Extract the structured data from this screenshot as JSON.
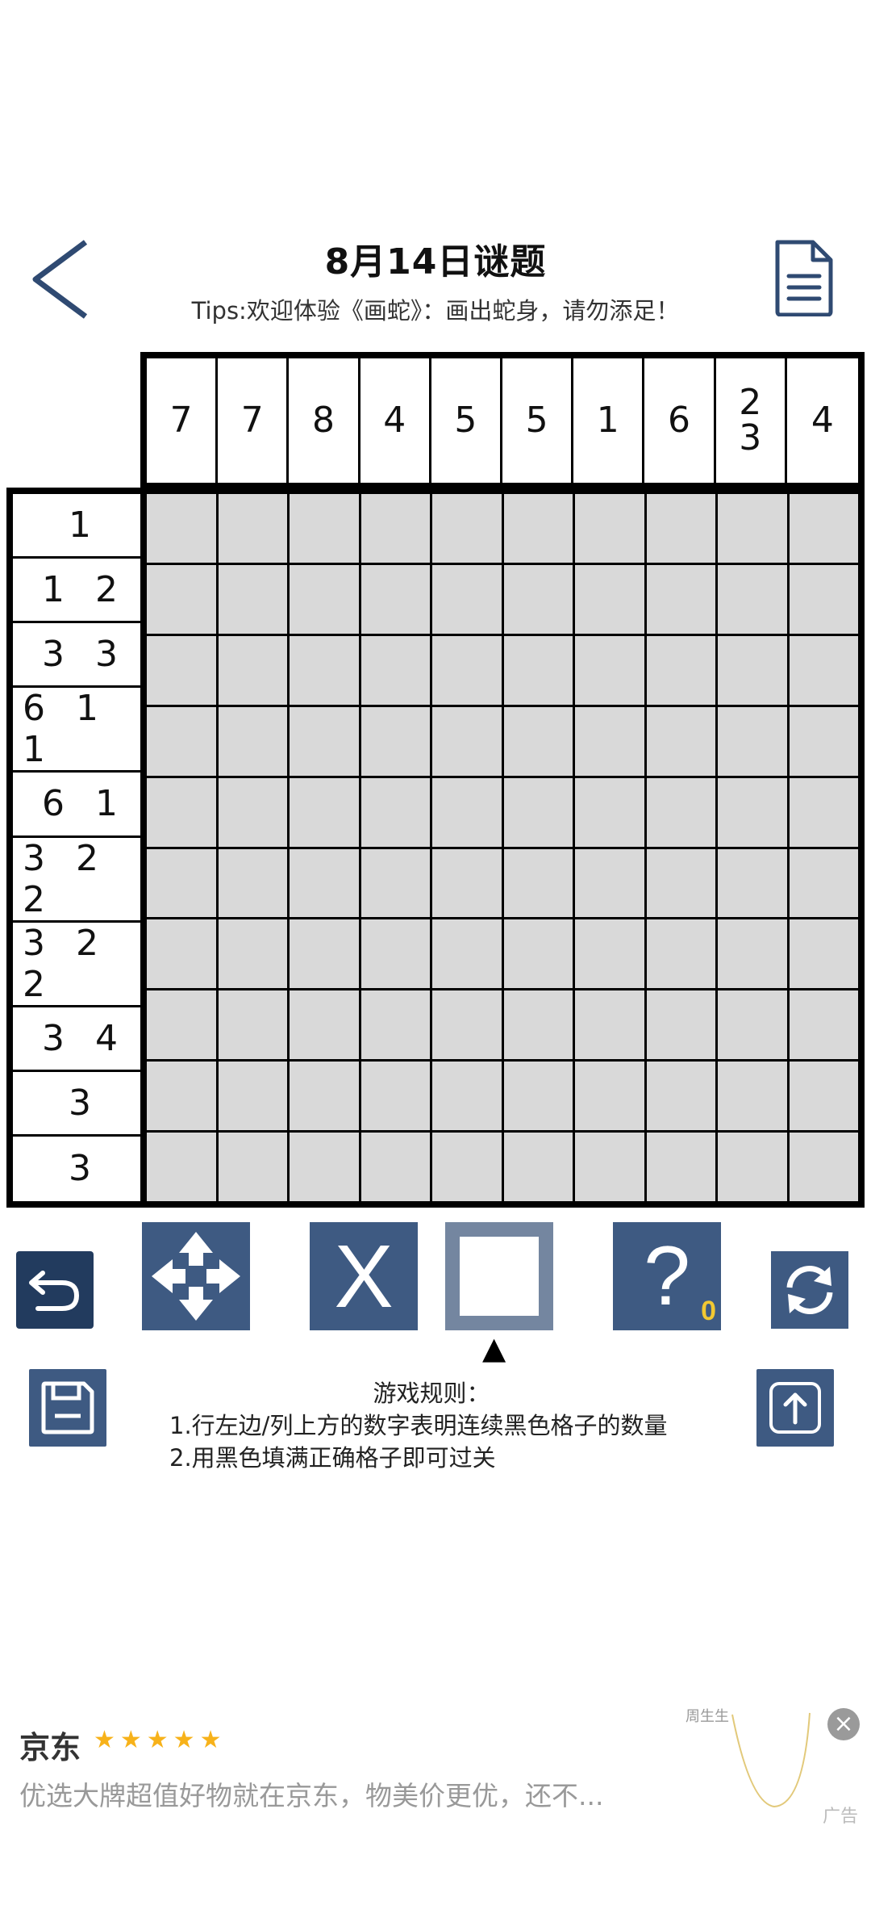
{
  "header": {
    "title": "8月14日谜题",
    "tips": "Tips:欢迎体验《画蛇》：画出蛇身，请勿添足！"
  },
  "puzzle": {
    "col_clues": [
      [
        "7"
      ],
      [
        "7"
      ],
      [
        "8"
      ],
      [
        "4"
      ],
      [
        "5"
      ],
      [
        "5"
      ],
      [
        "1"
      ],
      [
        "6"
      ],
      [
        "2",
        "3"
      ],
      [
        "4"
      ]
    ],
    "row_clues": [
      "1",
      "1 2",
      "3 3",
      "6 1 1",
      "6 1",
      "3 2 2",
      "3 2 2",
      "3 4",
      "3",
      "3"
    ],
    "rows": 10,
    "cols": 10
  },
  "toolbar": {
    "x_label": "X",
    "hint_label": "?",
    "hint_count": "0",
    "selected_indicator": "▲"
  },
  "rules": {
    "title": "游戏规则：",
    "line1": "1.行左边/列上方的数字表明连续黑色格子的数量",
    "line2": "2.用黑色填满正确格子即可过关"
  },
  "ad": {
    "brand": "京东",
    "stars": "★★★★★",
    "text": "优选大牌超值好物就在京东，物美价更优，还不...",
    "close": "×",
    "label": "广告",
    "mini_brand": "周生生"
  },
  "colors": {
    "button_dark": "#223b5e",
    "button": "#3e5a82",
    "button_selected": "#7486a0",
    "cell": "#d9d9d9",
    "star": "#f7b21a",
    "hint_count": "#f2c832"
  }
}
